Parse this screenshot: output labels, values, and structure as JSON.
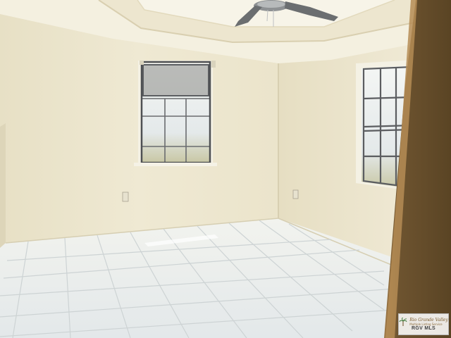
{
  "scene": {
    "description_colors": {
      "wall": "#ece6cf",
      "wall_shadow": "#ddd4b7",
      "ceiling": "#f3efdf",
      "floor_tile": "#e9eef0",
      "grout": "#c9ced0",
      "door_frame": "#8a6a40",
      "window_glass": "#e8eef2",
      "window_frame": "#5b5d60"
    }
  },
  "watermark": {
    "brand": "Rio Grande Valley",
    "tagline": "Multiple Listing Service",
    "mls": "RGV MLS"
  }
}
